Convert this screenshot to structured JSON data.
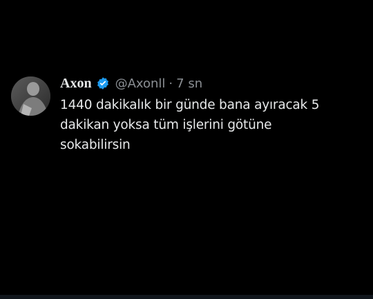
{
  "tweet": {
    "display_name": "Axon",
    "verified_icon": "verified-badge-icon",
    "handle": "@Axonll",
    "separator": "·",
    "time": "7 sn",
    "text_lines": [
      "1440 dakikalık bir günde bana ayıracak 5",
      "dakikan yoksa tüm işlerini götüne",
      "sokabilirsin"
    ]
  },
  "colors": {
    "background": "#000000",
    "primary_text": "#e7e9ea",
    "secondary_text": "#8b8f94",
    "verified_blue": "#1d9bf0"
  }
}
